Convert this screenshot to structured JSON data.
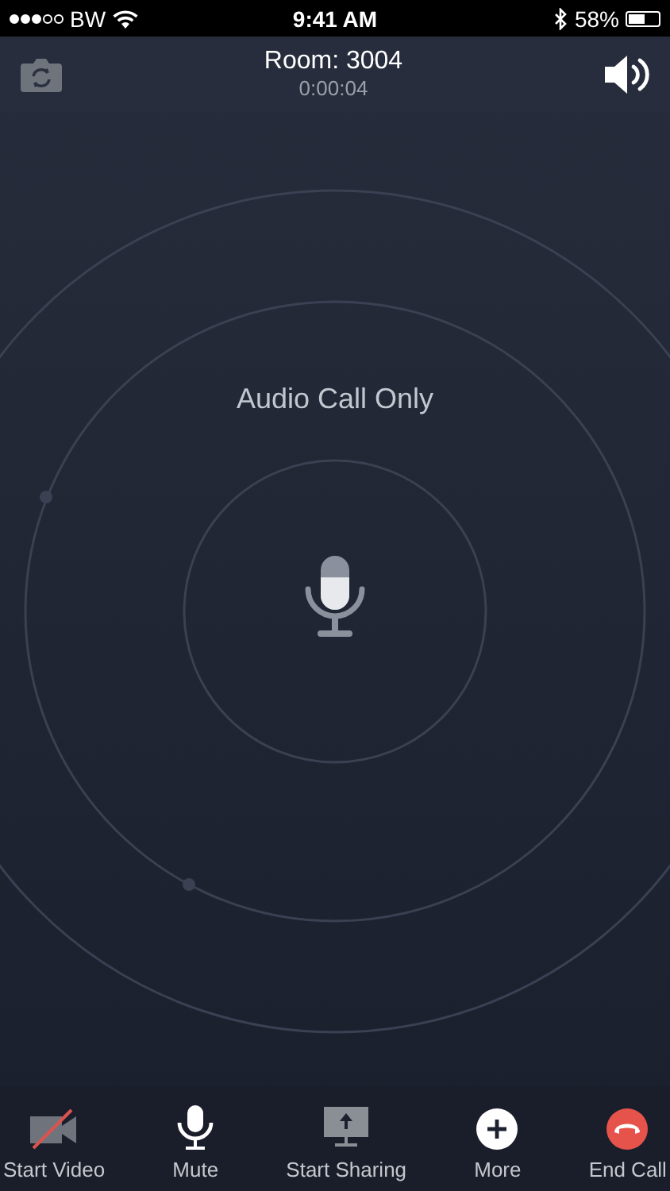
{
  "status_bar": {
    "carrier": "BW",
    "time": "9:41 AM",
    "battery": "58%"
  },
  "header": {
    "room": "Room: 3004",
    "duration": "0:00:04"
  },
  "call_mode": "Audio Call Only",
  "microphone": {
    "level": 0.6
  },
  "toolbar": [
    {
      "kind": "video-off",
      "label": "Start Video"
    },
    {
      "kind": "mic",
      "label": "Mute"
    },
    {
      "kind": "share",
      "label": "Start Sharing"
    },
    {
      "kind": "more",
      "label": "More"
    },
    {
      "kind": "end",
      "label": "End Call"
    }
  ]
}
